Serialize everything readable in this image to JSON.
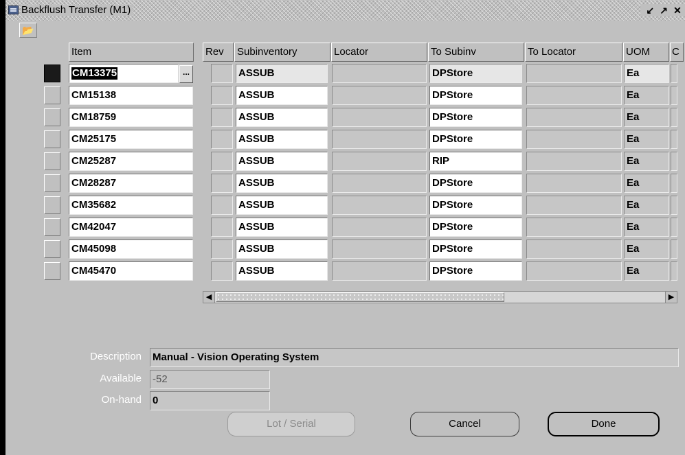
{
  "window": {
    "title": "Backflush Transfer (M1)",
    "controls": [
      "↙",
      "↗",
      "✕"
    ]
  },
  "toolbar": {
    "icon": "open-folder-icon"
  },
  "grid": {
    "headers": {
      "item": "Item",
      "rev": "Rev",
      "subinventory": "Subinventory",
      "locator": "Locator",
      "to_subinv": "To Subinv",
      "to_locator": "To Locator",
      "uom": "UOM",
      "extra": "C"
    },
    "lov_button": "...",
    "rows": [
      {
        "item": "CM13375",
        "rev": "",
        "subinventory": "ASSUB",
        "locator": "",
        "to_subinv": "DPStore",
        "to_locator": "",
        "uom": "Ea"
      },
      {
        "item": "CM15138",
        "rev": "",
        "subinventory": "ASSUB",
        "locator": "",
        "to_subinv": "DPStore",
        "to_locator": "",
        "uom": "Ea"
      },
      {
        "item": "CM18759",
        "rev": "",
        "subinventory": "ASSUB",
        "locator": "",
        "to_subinv": "DPStore",
        "to_locator": "",
        "uom": "Ea"
      },
      {
        "item": "CM25175",
        "rev": "",
        "subinventory": "ASSUB",
        "locator": "",
        "to_subinv": "DPStore",
        "to_locator": "",
        "uom": "Ea"
      },
      {
        "item": "CM25287",
        "rev": "",
        "subinventory": "ASSUB",
        "locator": "",
        "to_subinv": "RIP",
        "to_locator": "",
        "uom": "Ea"
      },
      {
        "item": "CM28287",
        "rev": "",
        "subinventory": "ASSUB",
        "locator": "",
        "to_subinv": "DPStore",
        "to_locator": "",
        "uom": "Ea"
      },
      {
        "item": "CM35682",
        "rev": "",
        "subinventory": "ASSUB",
        "locator": "",
        "to_subinv": "DPStore",
        "to_locator": "",
        "uom": "Ea"
      },
      {
        "item": "CM42047",
        "rev": "",
        "subinventory": "ASSUB",
        "locator": "",
        "to_subinv": "DPStore",
        "to_locator": "",
        "uom": "Ea"
      },
      {
        "item": "CM45098",
        "rev": "",
        "subinventory": "ASSUB",
        "locator": "",
        "to_subinv": "DPStore",
        "to_locator": "",
        "uom": "Ea"
      },
      {
        "item": "CM45470",
        "rev": "",
        "subinventory": "ASSUB",
        "locator": "",
        "to_subinv": "DPStore",
        "to_locator": "",
        "uom": "Ea"
      }
    ]
  },
  "details": {
    "description_label": "Description",
    "description_value": "Manual - Vision Operating System",
    "available_label": "Available",
    "available_value": "-52",
    "onhand_label": "On-hand",
    "onhand_value": "0"
  },
  "buttons": {
    "lot_serial": "Lot / Serial",
    "cancel": "Cancel",
    "done": "Done"
  }
}
